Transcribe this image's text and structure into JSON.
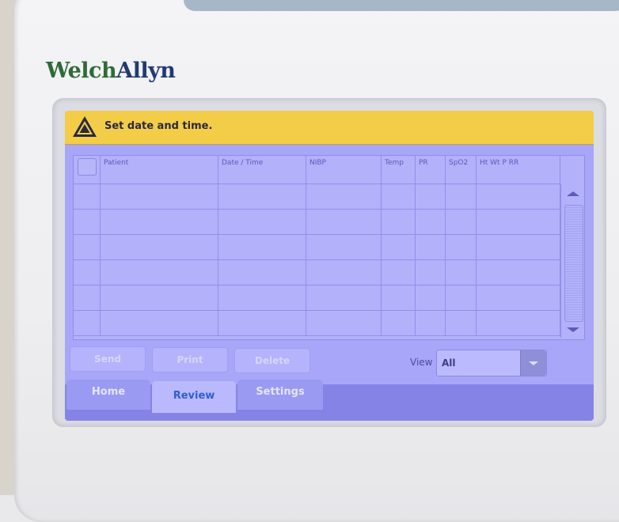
{
  "device": {
    "brand_part1": "Welch",
    "brand_part2": "Allyn"
  },
  "alert": {
    "icon": "warning-triangle-icon",
    "message": "Set date and time."
  },
  "table": {
    "columns": [
      "Patient",
      "Date / Time",
      "NIBP",
      "Temp",
      "PR",
      "SpO2",
      "Ht Wt P RR"
    ],
    "rows": [
      [
        "",
        "",
        "",
        "",
        "",
        "",
        ""
      ],
      [
        "",
        "",
        "",
        "",
        "",
        "",
        ""
      ],
      [
        "",
        "",
        "",
        "",
        "",
        "",
        ""
      ],
      [
        "",
        "",
        "",
        "",
        "",
        "",
        ""
      ],
      [
        "",
        "",
        "",
        "",
        "",
        "",
        ""
      ],
      [
        "",
        "",
        "",
        "",
        "",
        "",
        ""
      ]
    ]
  },
  "actions": {
    "send": "Send",
    "print": "Print",
    "delete": "Delete"
  },
  "view": {
    "label": "View",
    "selected": "All"
  },
  "tabs": [
    {
      "label": "Home",
      "active": false
    },
    {
      "label": "Review",
      "active": true
    },
    {
      "label": "Settings",
      "active": false
    }
  ],
  "colors": {
    "screen_bg": "#a7a6f8",
    "alert_bg": "#f3cd48",
    "active_tab_text": "#2f5fd0"
  }
}
